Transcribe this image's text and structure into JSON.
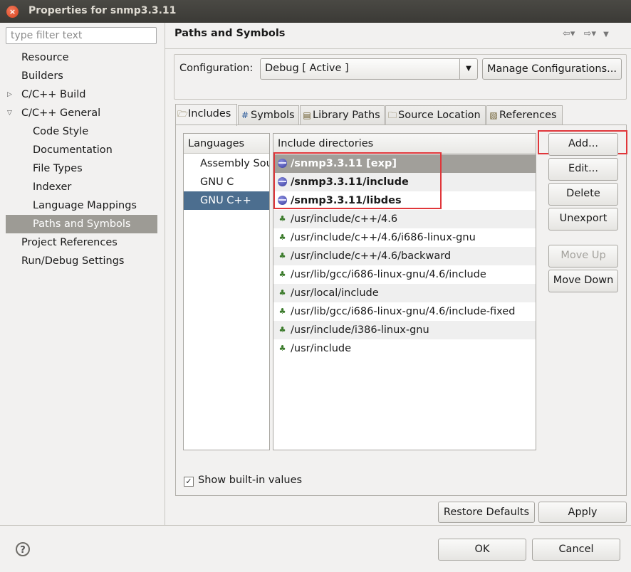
{
  "window": {
    "title": "Properties for snmp3.3.11",
    "close_glyph": "×"
  },
  "filter": {
    "placeholder": "type filter text"
  },
  "tree": {
    "items": [
      {
        "label": "Resource",
        "indent": 1,
        "expander": ""
      },
      {
        "label": "Builders",
        "indent": 1,
        "expander": ""
      },
      {
        "label": "C/C++ Build",
        "indent": 1,
        "expander": "collapsed"
      },
      {
        "label": "C/C++ General",
        "indent": 1,
        "expander": "expanded"
      },
      {
        "label": "Code Style",
        "indent": 2,
        "expander": ""
      },
      {
        "label": "Documentation",
        "indent": 2,
        "expander": ""
      },
      {
        "label": "File Types",
        "indent": 2,
        "expander": ""
      },
      {
        "label": "Indexer",
        "indent": 2,
        "expander": ""
      },
      {
        "label": "Language Mappings",
        "indent": 2,
        "expander": ""
      },
      {
        "label": "Paths and Symbols",
        "indent": 2,
        "expander": "",
        "selected": true
      },
      {
        "label": "Project References",
        "indent": 1,
        "expander": ""
      },
      {
        "label": "Run/Debug Settings",
        "indent": 1,
        "expander": ""
      }
    ]
  },
  "page": {
    "heading": "Paths and Symbols",
    "nav": {
      "back_icon": "back-arrow-icon",
      "forward_icon": "forward-arrow-icon",
      "menu_icon": "view-menu-icon"
    }
  },
  "configuration": {
    "label": "Configuration:",
    "value": "Debug  [ Active ]",
    "manage_label": "Manage Configurations..."
  },
  "tabs": [
    {
      "label": "Includes",
      "icon": "includes-icon",
      "active": true
    },
    {
      "label": "Symbols",
      "icon": "hash-icon"
    },
    {
      "label": "Library Paths",
      "icon": "library-icon"
    },
    {
      "label": "Source Location",
      "icon": "folder-icon"
    },
    {
      "label": "References",
      "icon": "references-icon"
    }
  ],
  "languages": {
    "header": "Languages",
    "items": [
      "Assembly Source",
      "GNU C",
      "GNU C++"
    ],
    "selected": "GNU C++"
  },
  "includes": {
    "header": "Include directories",
    "rows": [
      {
        "path": "/snmp3.3.11 [exp]",
        "kind": "project",
        "bold": true,
        "selected": true
      },
      {
        "path": "/snmp3.3.11/include",
        "kind": "project",
        "bold": true
      },
      {
        "path": "/snmp3.3.11/libdes",
        "kind": "project",
        "bold": true
      },
      {
        "path": "/usr/include/c++/4.6",
        "kind": "system"
      },
      {
        "path": "/usr/include/c++/4.6/i686-linux-gnu",
        "kind": "system"
      },
      {
        "path": "/usr/include/c++/4.6/backward",
        "kind": "system"
      },
      {
        "path": "/usr/lib/gcc/i686-linux-gnu/4.6/include",
        "kind": "system"
      },
      {
        "path": "/usr/local/include",
        "kind": "system"
      },
      {
        "path": "/usr/lib/gcc/i686-linux-gnu/4.6/include-fixed",
        "kind": "system"
      },
      {
        "path": "/usr/include/i386-linux-gnu",
        "kind": "system"
      },
      {
        "path": "/usr/include",
        "kind": "system"
      }
    ]
  },
  "side_buttons": [
    {
      "label": "Add...",
      "enabled": true
    },
    {
      "label": "Edit...",
      "enabled": true
    },
    {
      "label": "Delete",
      "enabled": true
    },
    {
      "label": "Unexport",
      "enabled": true
    },
    {
      "label": "Move Up",
      "enabled": false
    },
    {
      "label": "Move Down",
      "enabled": true
    }
  ],
  "show_builtin": {
    "label": "Show built-in values",
    "checked": true
  },
  "buttons": {
    "restore": "Restore Defaults",
    "apply": "Apply",
    "ok": "OK",
    "cancel": "Cancel"
  },
  "colors": {
    "highlight": "#e0363a",
    "selection": "#4c6e8f",
    "selected_row": "#a19f9a"
  }
}
